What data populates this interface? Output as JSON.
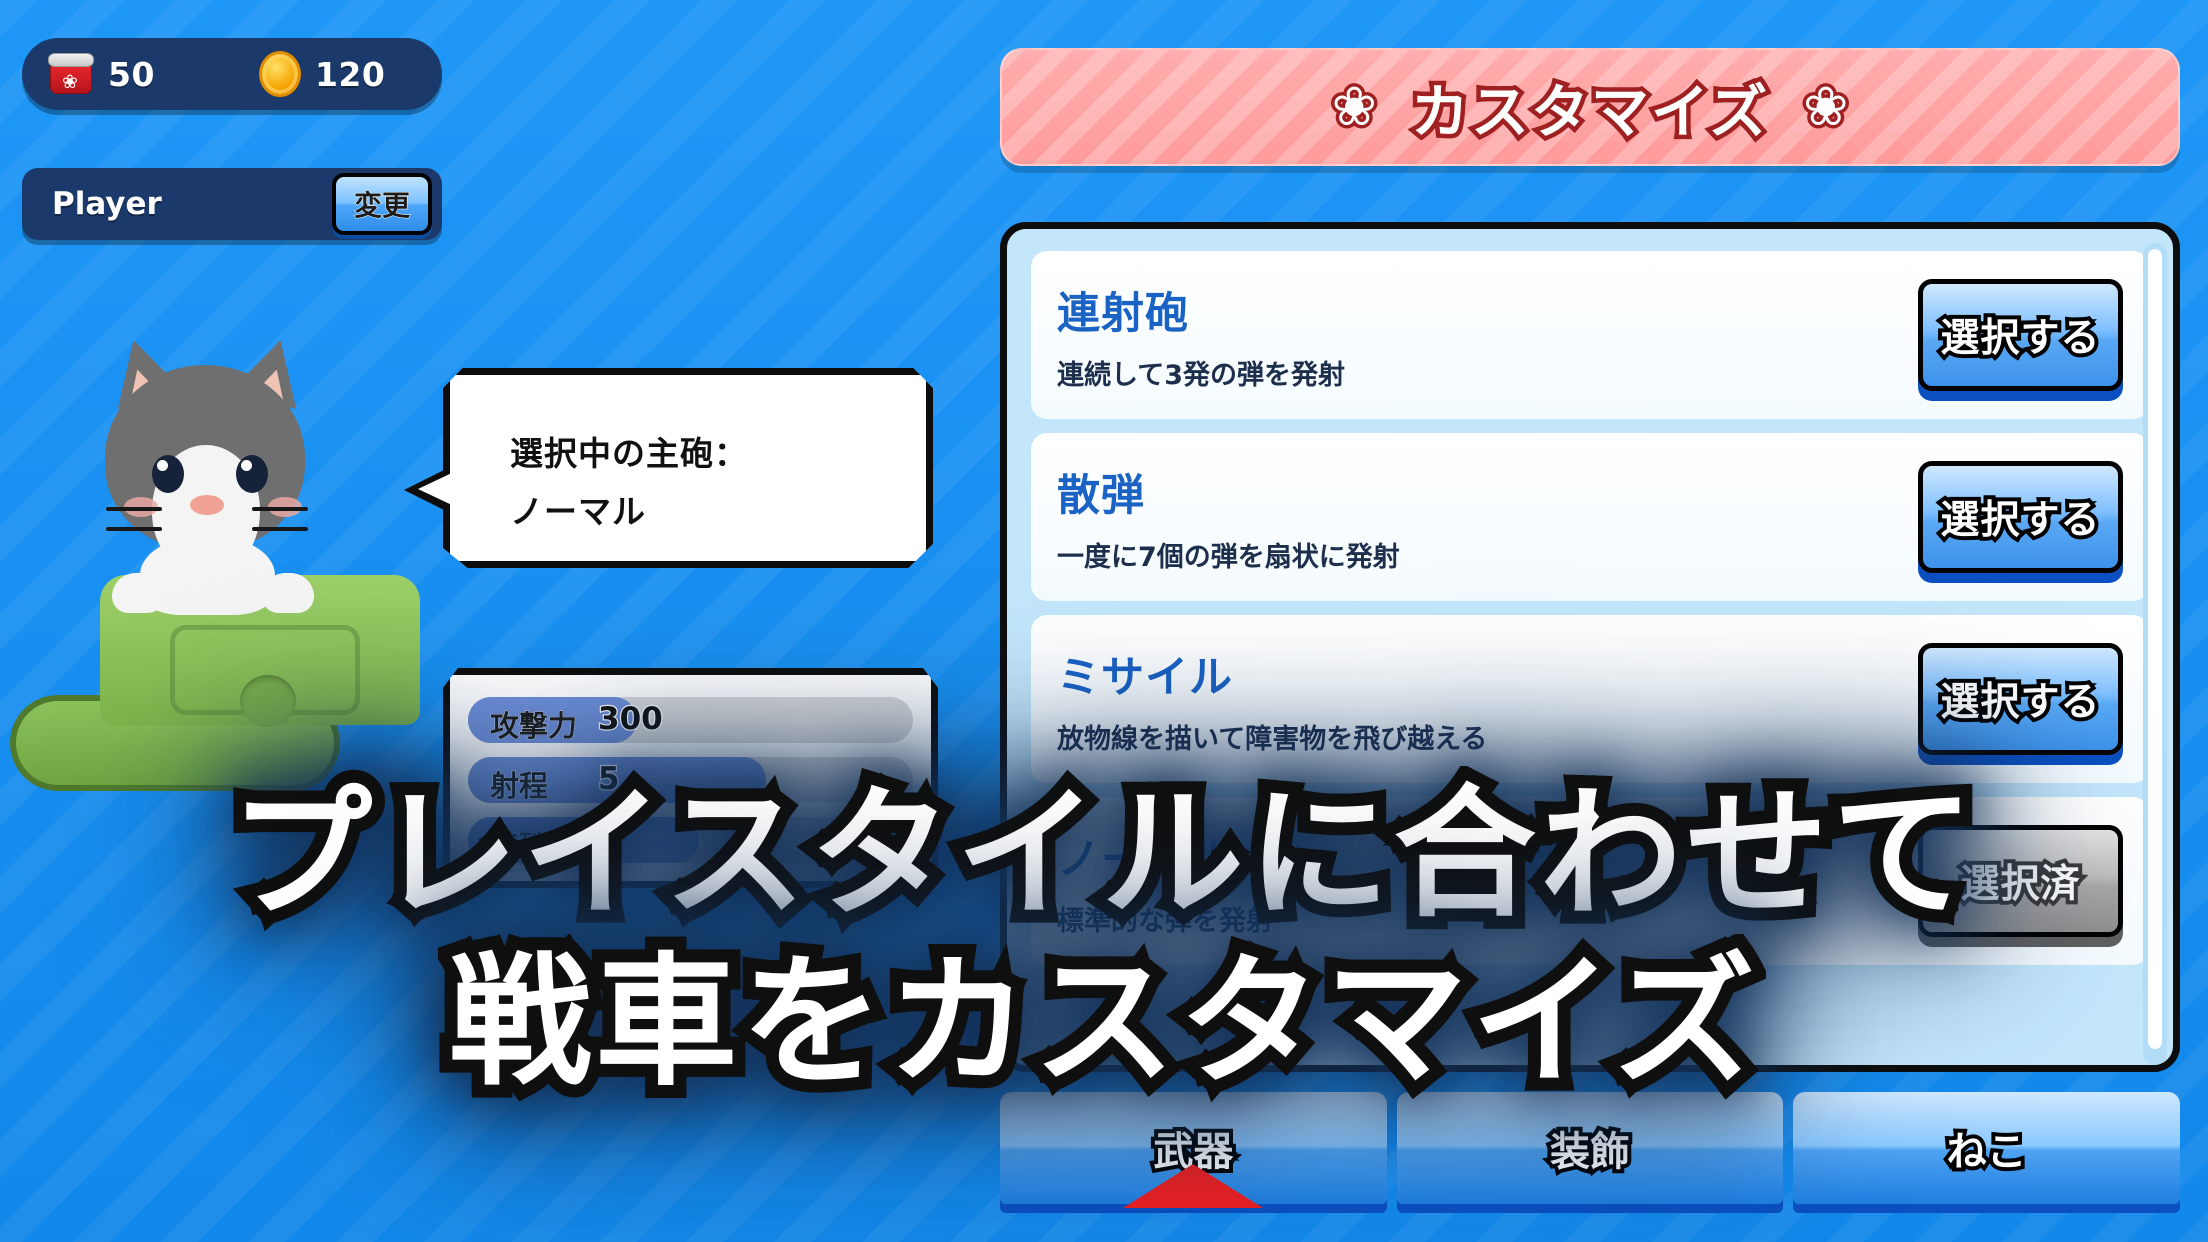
{
  "hud": {
    "can_icon": "cat-food-can-icon",
    "can_value": "50",
    "coin_icon": "coin-icon",
    "coin_value": "120",
    "player_name": "Player",
    "change_button": "変更"
  },
  "character": {
    "cat_name": "tuxedo-cat",
    "tank_name": "green-tank"
  },
  "speech": {
    "line1": "選択中の主砲：",
    "line2": "ノーマル"
  },
  "stats": {
    "rows": [
      {
        "label": "攻撃力",
        "value": "300",
        "fill_pct": 38
      },
      {
        "label": "射程",
        "value": "5",
        "fill_pct": 67
      },
      {
        "label": "特殊数",
        "value": "1",
        "fill_pct": 52
      }
    ]
  },
  "customize": {
    "title": "カスタマイズ",
    "paw_glyph": "❀"
  },
  "weapons": {
    "items": [
      {
        "name": "連射砲",
        "desc": "連続して3発の弾を発射",
        "button": "選択する",
        "selected": false
      },
      {
        "name": "散弾",
        "desc": "一度に7個の弾を扇状に発射",
        "button": "選択する",
        "selected": false
      },
      {
        "name": "ミサイル",
        "desc": "放物線を描いて障害物を飛び越える",
        "button": "選択する",
        "selected": false
      },
      {
        "name": "ノーマル",
        "desc": "標準的な弾を発射",
        "button": "選択済",
        "selected": true
      }
    ]
  },
  "tabs": [
    {
      "label": "武器",
      "active": true
    },
    {
      "label": "装飾",
      "active": false
    },
    {
      "label": "ねこ",
      "active": false
    }
  ],
  "promo": {
    "line1": "プレイスタイルに合わせて",
    "line2": "戦車をカスタマイズ"
  },
  "colors": {
    "background_blue": "#1a91f0",
    "hud_navy": "#1b3a6b",
    "header_pink": "#ff9b9b",
    "header_pink_stroke": "#9e2020",
    "panel_light_blue": "#c3e6fb",
    "weapon_name_blue": "#1a62c4",
    "button_blue": "#3d92ea",
    "button_grey": "#8f8f8f",
    "tab_active_red": "#ef2020",
    "stat_fill_blue": "#6f8fd8",
    "tank_green": "#7cb34a"
  }
}
